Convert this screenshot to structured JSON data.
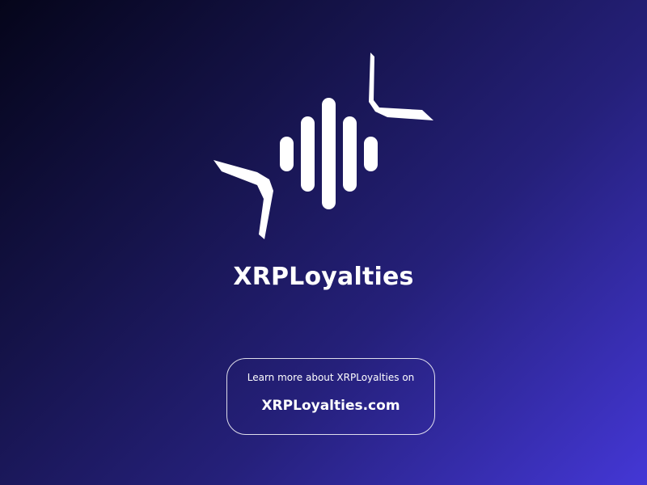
{
  "brand": {
    "name": "XRPLoyalties",
    "logo_icon": "sound-wave-brackets-icon",
    "logo_color": "#ffffff"
  },
  "cta": {
    "text": "Learn more about XRPLoyalties on",
    "link_label": "XRPLoyalties.com"
  },
  "theme": {
    "background_start": "#05051a",
    "background_end": "#4437d6",
    "text_color": "#ffffff"
  }
}
